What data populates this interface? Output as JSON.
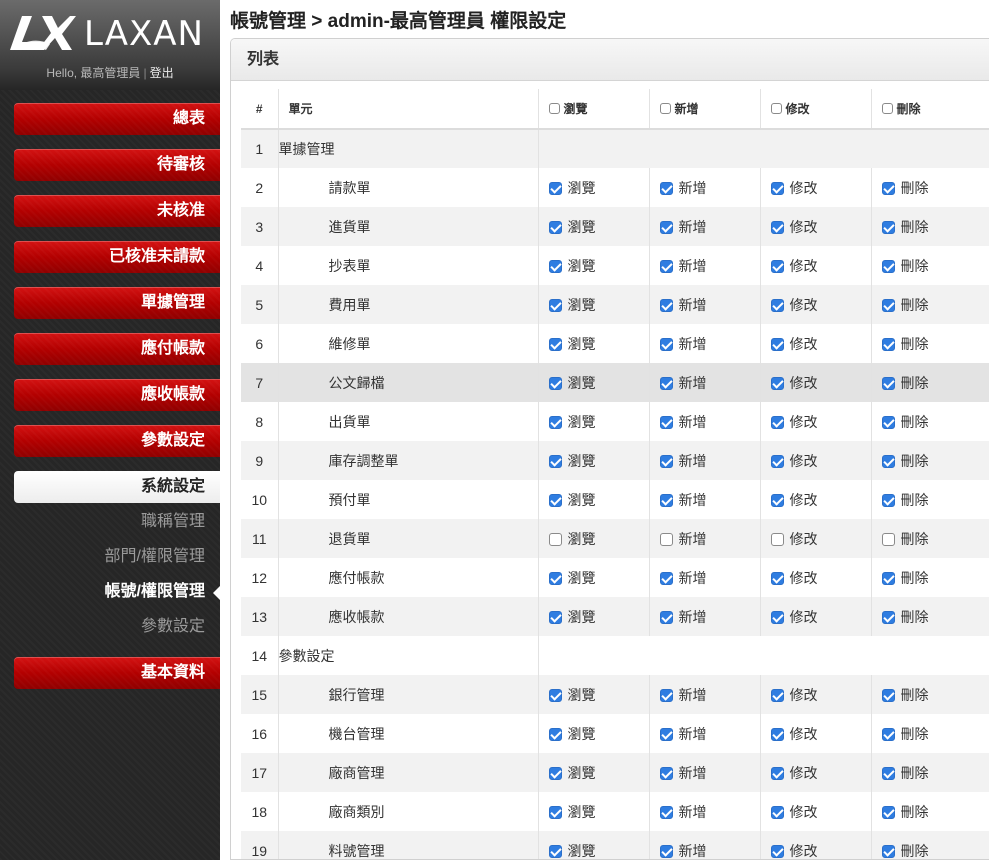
{
  "brand": {
    "name": "LAXAN"
  },
  "user": {
    "greeting": "Hello, 最高管理員",
    "separator": "|",
    "logout": "登出"
  },
  "nav": {
    "items": [
      {
        "label": "總表"
      },
      {
        "label": "待審核"
      },
      {
        "label": "未核准"
      },
      {
        "label": "已核准未請款"
      },
      {
        "label": "單據管理"
      },
      {
        "label": "應付帳款"
      },
      {
        "label": "應收帳款"
      },
      {
        "label": "參數設定"
      },
      {
        "label": "系統設定"
      },
      {
        "label": "基本資料"
      }
    ],
    "subitems": [
      {
        "label": "職稱管理"
      },
      {
        "label": "部門/權限管理"
      },
      {
        "label": "帳號/權限管理"
      },
      {
        "label": "參數設定"
      }
    ]
  },
  "page": {
    "title": "帳號管理 > admin-最高管理員 權限設定"
  },
  "panel": {
    "title": "列表"
  },
  "table": {
    "headers": {
      "num": "#",
      "unit": "單元",
      "view": "瀏覽",
      "add": "新增",
      "edit": "修改",
      "delete": "刪除"
    },
    "rows": [
      {
        "num": "1",
        "unit": "單據管理",
        "group": true
      },
      {
        "num": "2",
        "unit": "請款單",
        "view": "瀏覽",
        "add": "新增",
        "edit": "修改",
        "delete": "刪除",
        "checked": true
      },
      {
        "num": "3",
        "unit": "進貨單",
        "view": "瀏覽",
        "add": "新增",
        "edit": "修改",
        "delete": "刪除",
        "checked": true
      },
      {
        "num": "4",
        "unit": "抄表單",
        "view": "瀏覽",
        "add": "新增",
        "edit": "修改",
        "delete": "刪除",
        "checked": true
      },
      {
        "num": "5",
        "unit": "費用單",
        "view": "瀏覽",
        "add": "新增",
        "edit": "修改",
        "delete": "刪除",
        "checked": true
      },
      {
        "num": "6",
        "unit": "維修單",
        "view": "瀏覽",
        "add": "新增",
        "edit": "修改",
        "delete": "刪除",
        "checked": true
      },
      {
        "num": "7",
        "unit": "公文歸檔",
        "view": "瀏覽",
        "add": "新增",
        "edit": "修改",
        "delete": "刪除",
        "checked": true
      },
      {
        "num": "8",
        "unit": "出貨單",
        "view": "瀏覽",
        "add": "新增",
        "edit": "修改",
        "delete": "刪除",
        "checked": true
      },
      {
        "num": "9",
        "unit": "庫存調整單",
        "view": "瀏覽",
        "add": "新增",
        "edit": "修改",
        "delete": "刪除",
        "checked": true
      },
      {
        "num": "10",
        "unit": "預付單",
        "view": "瀏覽",
        "add": "新增",
        "edit": "修改",
        "delete": "刪除",
        "checked": true
      },
      {
        "num": "11",
        "unit": "退貨單",
        "view": "瀏覽",
        "add": "新增",
        "edit": "修改",
        "delete": "刪除",
        "checked": false
      },
      {
        "num": "12",
        "unit": "應付帳款",
        "view": "瀏覽",
        "add": "新增",
        "edit": "修改",
        "delete": "刪除",
        "checked": true
      },
      {
        "num": "13",
        "unit": "應收帳款",
        "view": "瀏覽",
        "add": "新增",
        "edit": "修改",
        "delete": "刪除",
        "checked": true
      },
      {
        "num": "14",
        "unit": "參數設定",
        "group": true
      },
      {
        "num": "15",
        "unit": "銀行管理",
        "view": "瀏覽",
        "add": "新增",
        "edit": "修改",
        "delete": "刪除",
        "checked": true
      },
      {
        "num": "16",
        "unit": "機台管理",
        "view": "瀏覽",
        "add": "新增",
        "edit": "修改",
        "delete": "刪除",
        "checked": true
      },
      {
        "num": "17",
        "unit": "廠商管理",
        "view": "瀏覽",
        "add": "新增",
        "edit": "修改",
        "delete": "刪除",
        "checked": true
      },
      {
        "num": "18",
        "unit": "廠商類別",
        "view": "瀏覽",
        "add": "新增",
        "edit": "修改",
        "delete": "刪除",
        "checked": true
      },
      {
        "num": "19",
        "unit": "料號管理",
        "view": "瀏覽",
        "add": "新增",
        "edit": "修改",
        "delete": "刪除",
        "checked": true
      }
    ]
  },
  "colors": {
    "accent_red": "#b30000",
    "checkbox_blue": "#2f7de1"
  }
}
